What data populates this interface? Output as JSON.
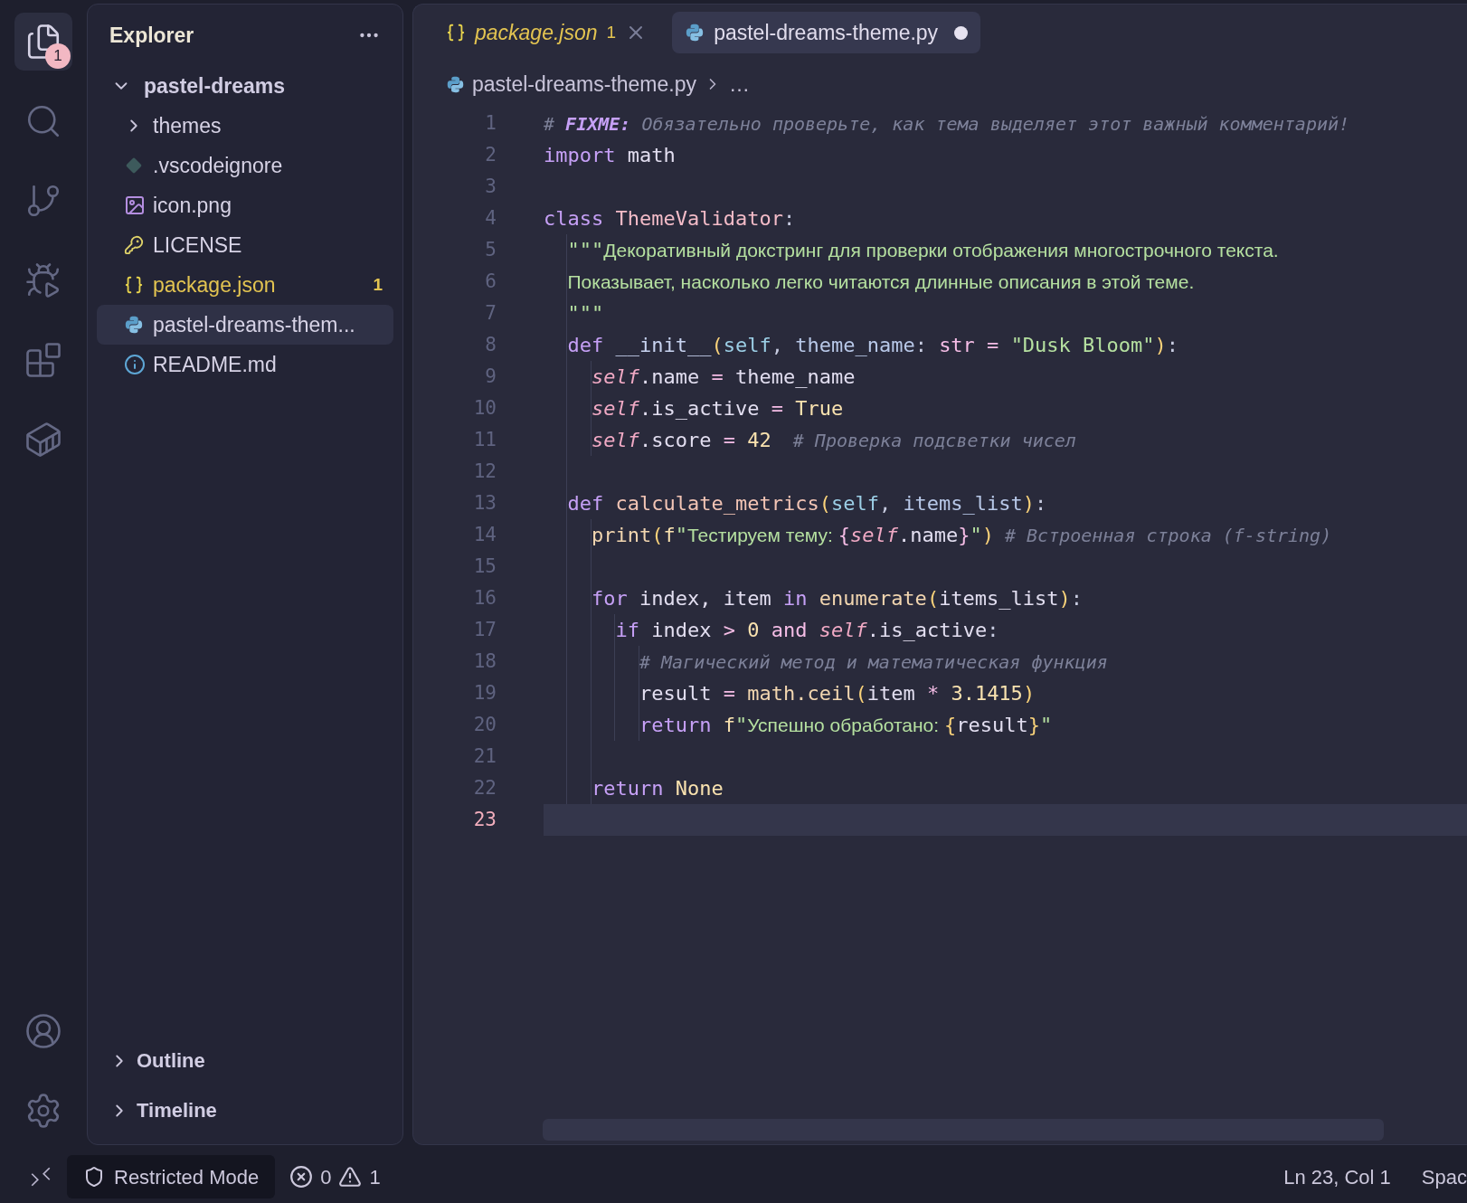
{
  "activity_bar": {
    "items": [
      {
        "kind": "files",
        "selected": true,
        "badge": "1"
      },
      {
        "kind": "search",
        "selected": false
      },
      {
        "kind": "source-control",
        "selected": false
      },
      {
        "kind": "run-debug",
        "selected": false
      },
      {
        "kind": "extensions",
        "selected": false
      },
      {
        "kind": "containers",
        "selected": false
      }
    ],
    "bottom": [
      {
        "kind": "account"
      },
      {
        "kind": "settings"
      }
    ]
  },
  "sidebar": {
    "title": "Explorer",
    "tree": [
      {
        "label": "pastel-dreams",
        "kind": "root",
        "expanded": true,
        "selected": false,
        "children": [
          {
            "label": "themes",
            "kind": "folder",
            "expanded": false,
            "selected": false,
            "warning": false
          },
          {
            "label": ".vscodeignore",
            "kind": "git",
            "selected": false,
            "warning": false
          },
          {
            "label": "icon.png",
            "kind": "image",
            "selected": false,
            "warning": false
          },
          {
            "label": "LICENSE",
            "kind": "license",
            "selected": false,
            "warning": false
          },
          {
            "label": "package.json",
            "kind": "json",
            "selected": false,
            "warning": true,
            "badge": "1"
          },
          {
            "label": "pastel-dreams-them...",
            "kind": "python",
            "selected": true,
            "warning": false
          },
          {
            "label": "README.md",
            "kind": "info",
            "selected": false,
            "warning": false
          }
        ]
      }
    ],
    "sections": [
      {
        "label": "Outline",
        "expanded": false
      },
      {
        "label": "Timeline",
        "expanded": false
      }
    ]
  },
  "editor": {
    "tabs": [
      {
        "label": "package.json",
        "kind": "json",
        "selected": false,
        "preview": true,
        "warning": true,
        "badge": "1",
        "dirty": false
      },
      {
        "label": "pastel-dreams-theme.py",
        "kind": "python",
        "selected": true,
        "preview": false,
        "warning": false,
        "dirty": true
      }
    ],
    "breadcrumb": [
      "pastel-dreams-theme.py",
      "…"
    ],
    "lines": [
      {
        "number": "1",
        "selected": false,
        "tokens": [
          {
            "text": "# ",
            "kind": "comment"
          },
          {
            "text": "FIXME:",
            "kind": "todo"
          },
          {
            "text": " Обязательно проверьте, как тема выделяет этот важный комментарий!",
            "kind": "comment"
          }
        ]
      },
      {
        "number": "2",
        "selected": false,
        "tokens": [
          {
            "text": "import ",
            "kind": "keyword"
          },
          {
            "text": "math",
            "kind": "plain"
          }
        ]
      },
      {
        "number": "3",
        "selected": false
      },
      {
        "number": "4",
        "selected": false,
        "tokens": [
          {
            "text": "class ",
            "kind": "keyword"
          },
          {
            "text": "ThemeValidator",
            "kind": "class"
          },
          {
            "text": ":",
            "kind": "punct"
          }
        ],
        "children": [
          {
            "number": "5",
            "selected": false,
            "tokens": [
              {
                "text": "\"\"\"",
                "kind": "string"
              },
              {
                "text": "Декоративный докстринг для проверки отображения многострочного текста.",
                "kind": "docstring"
              }
            ]
          },
          {
            "number": "6",
            "selected": false,
            "tokens": [
              {
                "text": "Показывает, насколько легко читаются длинные описания в этой теме.",
                "kind": "docstring"
              }
            ]
          },
          {
            "number": "7",
            "selected": false,
            "tokens": [
              {
                "text": "\"\"\"",
                "kind": "string"
              }
            ]
          },
          {
            "number": "8",
            "selected": false,
            "tokens": [
              {
                "text": "def ",
                "kind": "keyword"
              },
              {
                "text": "__init__",
                "kind": "dunder"
              },
              {
                "text": "(",
                "kind": "bracket"
              },
              {
                "text": "self",
                "kind": "self-param"
              },
              {
                "text": ", ",
                "kind": "punct"
              },
              {
                "text": "theme_name",
                "kind": "param"
              },
              {
                "text": ": ",
                "kind": "punct"
              },
              {
                "text": "str",
                "kind": "type"
              },
              {
                "text": " = ",
                "kind": "operator"
              },
              {
                "text": "\"Dusk Bloom\"",
                "kind": "string"
              },
              {
                "text": ")",
                "kind": "bracket"
              },
              {
                "text": ":",
                "kind": "punct"
              }
            ],
            "children": [
              {
                "number": "9",
                "selected": false,
                "tokens": [
                  {
                    "text": "self",
                    "kind": "self"
                  },
                  {
                    "text": ".name",
                    "kind": "plain"
                  },
                  {
                    "text": " = ",
                    "kind": "operator"
                  },
                  {
                    "text": "theme_name",
                    "kind": "plain"
                  }
                ]
              },
              {
                "number": "10",
                "selected": false,
                "tokens": [
                  {
                    "text": "self",
                    "kind": "self"
                  },
                  {
                    "text": ".is_active",
                    "kind": "plain"
                  },
                  {
                    "text": " = ",
                    "kind": "operator"
                  },
                  {
                    "text": "True",
                    "kind": "constant"
                  }
                ]
              },
              {
                "number": "11",
                "selected": false,
                "tokens": [
                  {
                    "text": "self",
                    "kind": "self"
                  },
                  {
                    "text": ".score",
                    "kind": "plain"
                  },
                  {
                    "text": " = ",
                    "kind": "operator"
                  },
                  {
                    "text": "42",
                    "kind": "number"
                  },
                  {
                    "text": "  # Проверка подсветки чисел",
                    "kind": "comment"
                  }
                ]
              }
            ]
          },
          {
            "number": "12",
            "selected": false
          },
          {
            "number": "13",
            "selected": false,
            "tokens": [
              {
                "text": "def ",
                "kind": "keyword"
              },
              {
                "text": "calculate_metrics",
                "kind": "function"
              },
              {
                "text": "(",
                "kind": "bracket"
              },
              {
                "text": "self",
                "kind": "self-param"
              },
              {
                "text": ", ",
                "kind": "punct"
              },
              {
                "text": "items_list",
                "kind": "param"
              },
              {
                "text": ")",
                "kind": "bracket"
              },
              {
                "text": ":",
                "kind": "punct"
              }
            ],
            "children": [
              {
                "number": "14",
                "selected": false,
                "tokens": [
                  {
                    "text": "print",
                    "kind": "builtin"
                  },
                  {
                    "text": "(",
                    "kind": "bracket"
                  },
                  {
                    "text": "f",
                    "kind": "prefix"
                  },
                  {
                    "text": "\"",
                    "kind": "string"
                  },
                  {
                    "text": "Тестируем тему: ",
                    "kind": "string-text"
                  },
                  {
                    "text": "{",
                    "kind": "interp"
                  },
                  {
                    "text": "self",
                    "kind": "self"
                  },
                  {
                    "text": ".name",
                    "kind": "plain"
                  },
                  {
                    "text": "}",
                    "kind": "interp"
                  },
                  {
                    "text": "\"",
                    "kind": "string"
                  },
                  {
                    "text": ")",
                    "kind": "bracket"
                  },
                  {
                    "text": " # Встроенная строка (f-string)",
                    "kind": "comment"
                  }
                ]
              },
              {
                "number": "15",
                "selected": false
              },
              {
                "number": "16",
                "selected": false,
                "tokens": [
                  {
                    "text": "for ",
                    "kind": "keyword"
                  },
                  {
                    "text": "index, item ",
                    "kind": "plain"
                  },
                  {
                    "text": "in ",
                    "kind": "keyword"
                  },
                  {
                    "text": "enumerate",
                    "kind": "builtin"
                  },
                  {
                    "text": "(",
                    "kind": "bracket"
                  },
                  {
                    "text": "items_list",
                    "kind": "plain"
                  },
                  {
                    "text": ")",
                    "kind": "bracket"
                  },
                  {
                    "text": ":",
                    "kind": "punct"
                  }
                ],
                "children": [
                  {
                    "number": "17",
                    "selected": false,
                    "tokens": [
                      {
                        "text": "if ",
                        "kind": "keyword"
                      },
                      {
                        "text": "index ",
                        "kind": "plain"
                      },
                      {
                        "text": "> ",
                        "kind": "operator"
                      },
                      {
                        "text": "0 ",
                        "kind": "number"
                      },
                      {
                        "text": "and ",
                        "kind": "operator"
                      },
                      {
                        "text": "self",
                        "kind": "self"
                      },
                      {
                        "text": ".is_active",
                        "kind": "plain"
                      },
                      {
                        "text": ":",
                        "kind": "punct"
                      }
                    ],
                    "children": [
                      {
                        "number": "18",
                        "selected": false,
                        "tokens": [
                          {
                            "text": "# Магический метод и математическая функция",
                            "kind": "comment"
                          }
                        ]
                      },
                      {
                        "number": "19",
                        "selected": false,
                        "tokens": [
                          {
                            "text": "result",
                            "kind": "plain"
                          },
                          {
                            "text": " = ",
                            "kind": "operator"
                          },
                          {
                            "text": "math.ceil",
                            "kind": "builtin"
                          },
                          {
                            "text": "(",
                            "kind": "bracket"
                          },
                          {
                            "text": "item",
                            "kind": "plain"
                          },
                          {
                            "text": " * ",
                            "kind": "operator"
                          },
                          {
                            "text": "3.1415",
                            "kind": "number"
                          },
                          {
                            "text": ")",
                            "kind": "bracket"
                          }
                        ]
                      },
                      {
                        "number": "20",
                        "selected": false,
                        "tokens": [
                          {
                            "text": "return ",
                            "kind": "keyword"
                          },
                          {
                            "text": "f",
                            "kind": "prefix"
                          },
                          {
                            "text": "\"",
                            "kind": "string"
                          },
                          {
                            "text": "Успешно обработано: ",
                            "kind": "string-text"
                          },
                          {
                            "text": "{",
                            "kind": "bracket"
                          },
                          {
                            "text": "result",
                            "kind": "plain"
                          },
                          {
                            "text": "}",
                            "kind": "bracket"
                          },
                          {
                            "text": "\"",
                            "kind": "string"
                          }
                        ]
                      }
                    ]
                  }
                ]
              },
              {
                "number": "21",
                "selected": false
              },
              {
                "number": "22",
                "selected": false,
                "tokens": [
                  {
                    "text": "return ",
                    "kind": "keyword"
                  },
                  {
                    "text": "None",
                    "kind": "constant"
                  }
                ]
              }
            ]
          }
        ]
      },
      {
        "number": "23",
        "selected": true
      }
    ]
  },
  "status_bar": {
    "mode": "Restricted Mode",
    "errors": "0",
    "warnings": "1",
    "position": "Ln 23, Col 1",
    "indentation": "Spac"
  }
}
